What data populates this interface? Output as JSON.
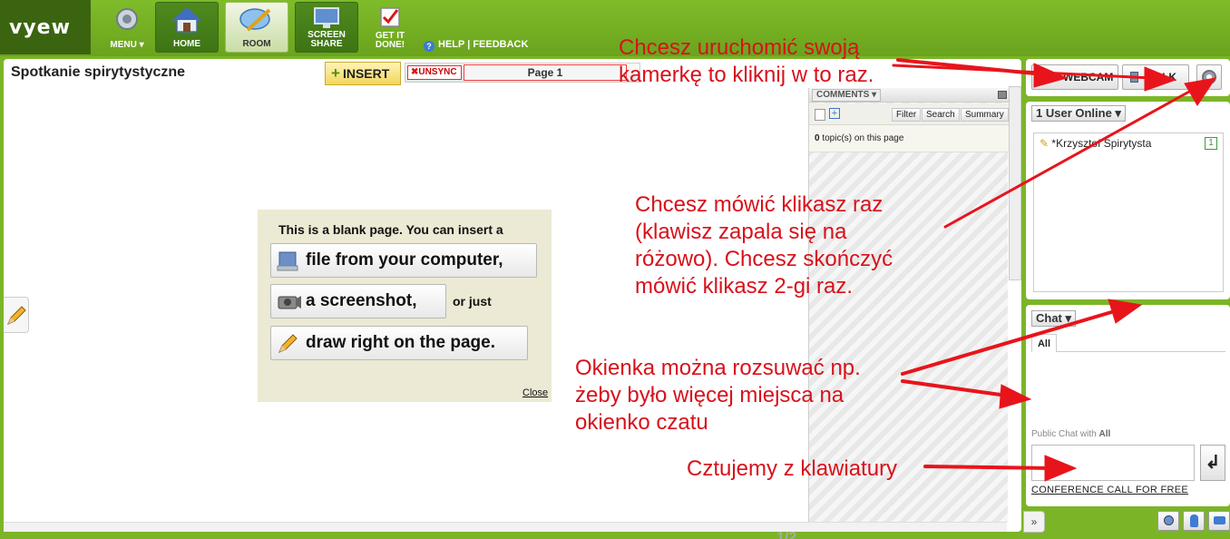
{
  "app": {
    "logo_text": "vyew",
    "nav": {
      "menu": "MENU",
      "home": "HOME",
      "room": "ROOM",
      "screen_share_line1": "SCREEN",
      "screen_share_line2": "SHARE",
      "get_it_done_line1": "GET IT",
      "get_it_done_line2": "DONE!",
      "help": "HELP | FEEDBACK"
    }
  },
  "room": {
    "title": "Spotkanie spirytystyczne",
    "insert_label": "INSERT",
    "unsync_label": "UNSYNC",
    "page_label": "Page 1",
    "page_count": "1/2"
  },
  "blank_page": {
    "title": "This is a blank page. You can insert a",
    "opt_file": "file from your computer,",
    "opt_screenshot": "a screenshot,",
    "or_just": "or just",
    "opt_draw": "draw right on the page.",
    "close": "Close"
  },
  "comments": {
    "tab": "COMMENTS",
    "filter": "Filter",
    "search": "Search",
    "summary": "Summary",
    "topics_count": "0",
    "topics_text": "topic(s) on this page"
  },
  "media": {
    "webcam": "WEBCAM",
    "talk": "TALK"
  },
  "users": {
    "header": "1 User Online",
    "list": [
      {
        "name": "*Krzysztof Spirytysta",
        "badge": "1"
      }
    ]
  },
  "chat": {
    "header": "Chat",
    "tab_all": "All",
    "public_with_prefix": "Public Chat with",
    "public_with_target": "All",
    "send_symbol": "↲",
    "conference_link": "CONFERENCE CALL FOR FREE"
  },
  "annotations": {
    "webcam_line1": "Chcesz uruchomić swoją",
    "webcam_line2": "kamerkę to kliknij w to raz.",
    "talk_line1": "Chcesz mówić klikasz raz",
    "talk_line2": "(klawisz zapala się na",
    "talk_line3": "różowo). Chcesz skończyć",
    "talk_line4": "mówić klikasz 2-gi raz.",
    "resize_line1": "Okienka można rozsuwać np.",
    "resize_line2": "żeby było więcej miejsca na",
    "resize_line3": "okienko czatu",
    "keyboard": "Cztujemy z klawiatury",
    "color": "#d8111b"
  }
}
